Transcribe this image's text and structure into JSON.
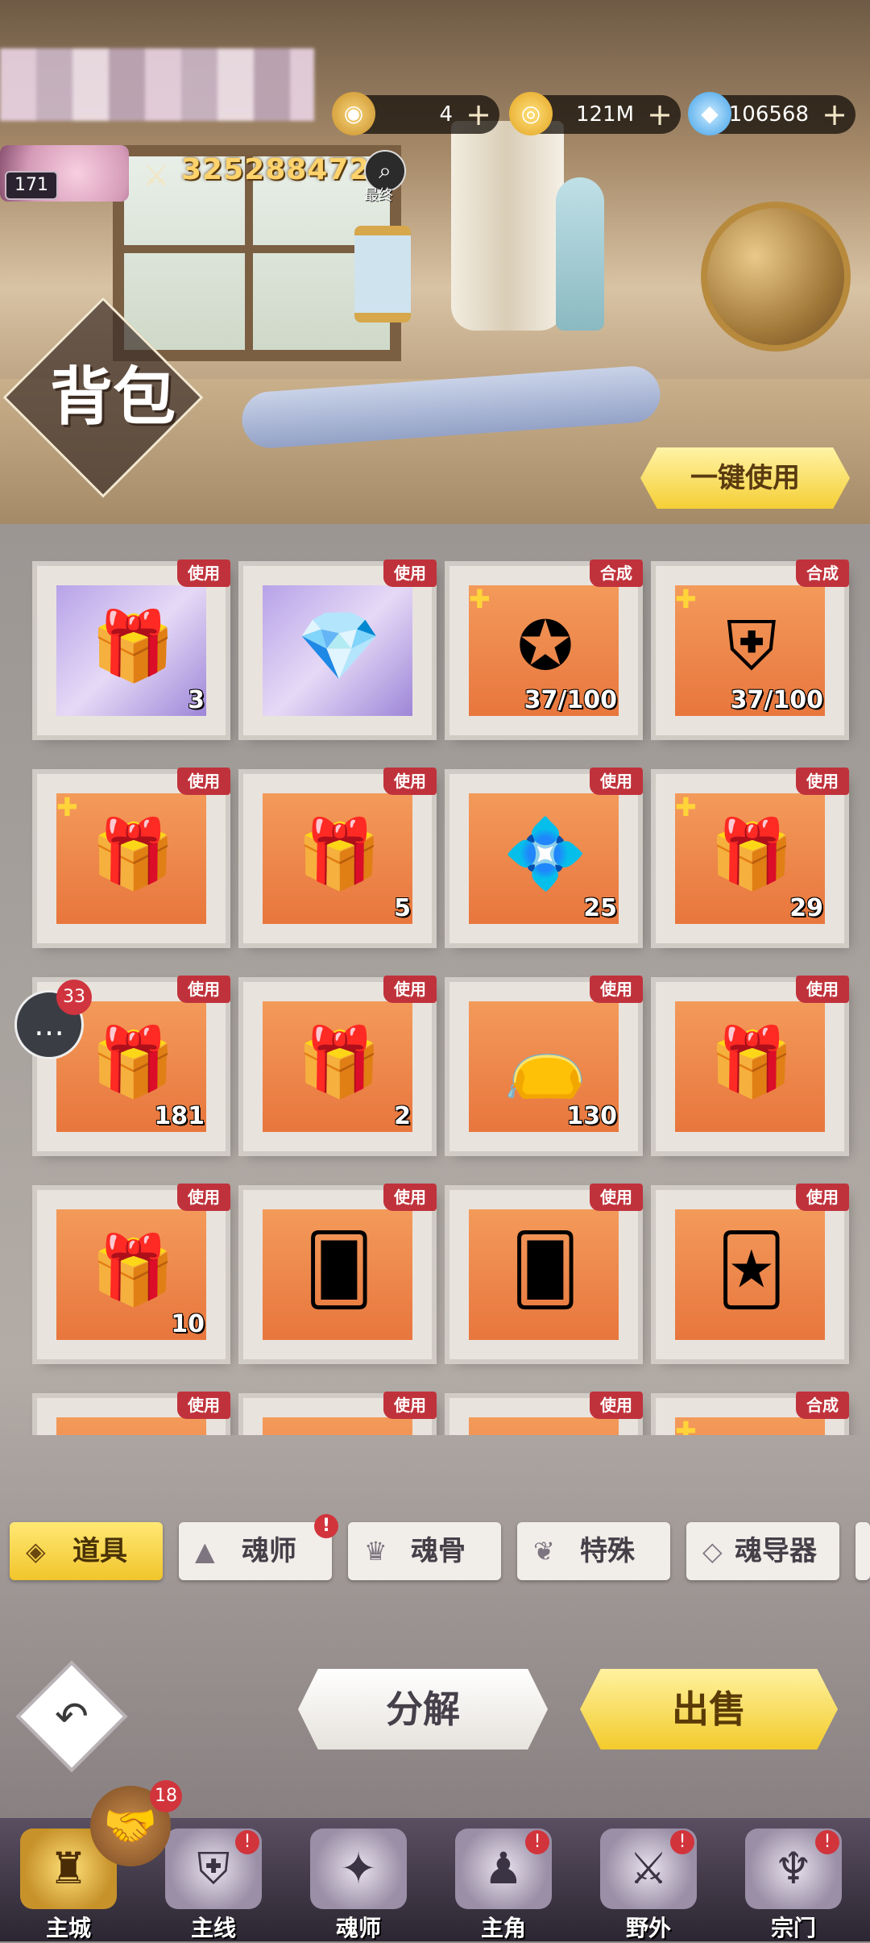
{
  "header": {
    "level": "171",
    "power": "325288472",
    "search_label": "最终",
    "title": "背包",
    "use_all_label": "一键使用"
  },
  "currencies": [
    {
      "icon": "medal-coin-icon",
      "value": "4"
    },
    {
      "icon": "gold-coin-icon",
      "value": "121M"
    },
    {
      "icon": "diamond-icon",
      "value": "106568"
    }
  ],
  "items": [
    {
      "tag": "使用",
      "count": "3",
      "icon": "character-chest-icon",
      "style": "purple"
    },
    {
      "tag": "使用",
      "count": "",
      "icon": "treasure-chest-icon",
      "style": "purple"
    },
    {
      "tag": "合成",
      "count": "37/100",
      "icon": "star-medallion-icon",
      "puzzle": true
    },
    {
      "tag": "合成",
      "count": "37/100",
      "icon": "golden-armor-icon",
      "puzzle": true
    },
    {
      "tag": "使用",
      "count": "",
      "icon": "golden-chest-icon",
      "puzzle": true
    },
    {
      "tag": "使用",
      "count": "5",
      "icon": "red-chest-icon"
    },
    {
      "tag": "使用",
      "count": "25",
      "icon": "gem-chest-icon"
    },
    {
      "tag": "使用",
      "count": "29",
      "icon": "golden-chest-icon",
      "puzzle": true
    },
    {
      "tag": "使用",
      "count": "181",
      "icon": "blue-chest-icon"
    },
    {
      "tag": "使用",
      "count": "2",
      "icon": "winged-chest-icon"
    },
    {
      "tag": "使用",
      "count": "130",
      "icon": "gift-bag-icon"
    },
    {
      "tag": "使用",
      "count": "",
      "icon": "blue-chest-icon"
    },
    {
      "tag": "使用",
      "count": "10",
      "icon": "red-gold-chest-icon"
    },
    {
      "tag": "使用",
      "count": "",
      "icon": "card-box-icon"
    },
    {
      "tag": "使用",
      "count": "",
      "icon": "card-box-icon"
    },
    {
      "tag": "使用",
      "count": "",
      "icon": "card-fan-icon"
    },
    {
      "tag": "使用",
      "count": "",
      "icon": "chest-icon"
    },
    {
      "tag": "使用",
      "count": "",
      "icon": "chest-icon"
    },
    {
      "tag": "使用",
      "count": "",
      "icon": "chest-icon"
    },
    {
      "tag": "合成",
      "count": "",
      "icon": "orb-icon",
      "puzzle": true
    }
  ],
  "chat": {
    "badge": "33"
  },
  "tabs": [
    {
      "label": "道具",
      "icon": "item-icon",
      "active": true
    },
    {
      "label": "魂师",
      "icon": "soul-master-icon",
      "dot": "!"
    },
    {
      "label": "魂骨",
      "icon": "soul-bone-icon"
    },
    {
      "label": "特殊",
      "icon": "special-icon"
    },
    {
      "label": "魂导器",
      "icon": "soul-device-icon"
    }
  ],
  "actions": {
    "decompose": "分解",
    "sell": "出售"
  },
  "nav": {
    "handshake_badge": "18",
    "items": [
      {
        "label": "主城",
        "icon": "castle-icon",
        "active": true
      },
      {
        "label": "主线",
        "icon": "mainline-icon",
        "dot": "!"
      },
      {
        "label": "魂师",
        "icon": "book-icon"
      },
      {
        "label": "主角",
        "icon": "hero-icon",
        "dot": "!"
      },
      {
        "label": "野外",
        "icon": "wild-icon",
        "dot": "!"
      },
      {
        "label": "宗门",
        "icon": "sect-icon",
        "dot": "!"
      }
    ]
  }
}
